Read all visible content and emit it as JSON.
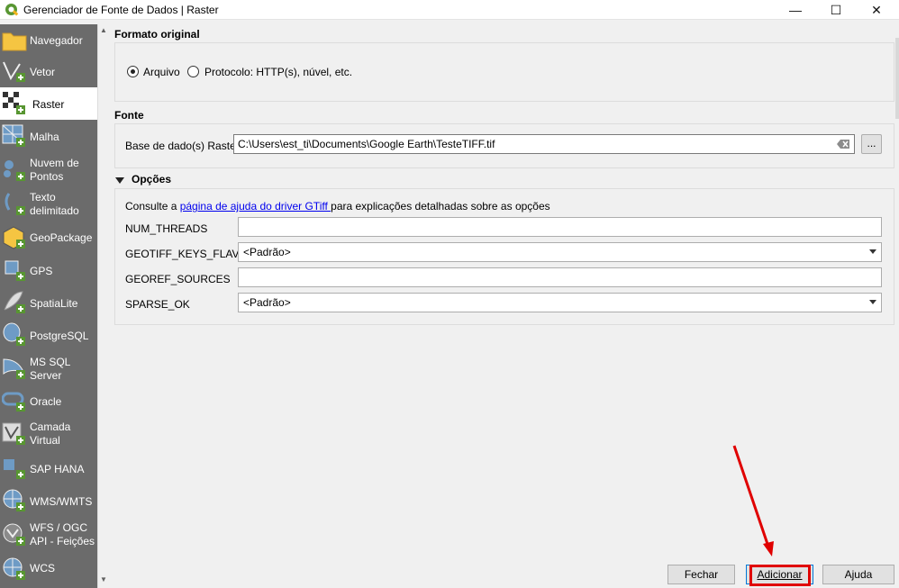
{
  "window": {
    "title": "Gerenciador de Fonte de Dados | Raster",
    "minimize": "—",
    "maximize": "☐",
    "close": "✕"
  },
  "sidebar": {
    "items": [
      {
        "label": "Navegador",
        "icon": "folder-icon"
      },
      {
        "label": "Vetor",
        "icon": "vector-add-icon"
      },
      {
        "label": "Raster",
        "icon": "raster-add-icon",
        "selected": true
      },
      {
        "label": "Malha",
        "icon": "mesh-add-icon"
      },
      {
        "label": "Nuvem de\nPontos",
        "icon": "point-cloud-add-icon"
      },
      {
        "label": "Texto\ndelimitado",
        "icon": "delimited-text-add-icon"
      },
      {
        "label": "GeoPackage",
        "icon": "geopackage-add-icon"
      },
      {
        "label": "GPS",
        "icon": "gps-add-icon"
      },
      {
        "label": "SpatiaLite",
        "icon": "spatialite-add-icon"
      },
      {
        "label": "PostgreSQL",
        "icon": "postgresql-add-icon"
      },
      {
        "label": "MS SQL\nServer",
        "icon": "mssql-add-icon"
      },
      {
        "label": "Oracle",
        "icon": "oracle-add-icon"
      },
      {
        "label": "Camada\nVirtual",
        "icon": "virtual-layer-add-icon"
      },
      {
        "label": "SAP HANA",
        "icon": "sap-hana-add-icon"
      },
      {
        "label": "WMS/WMTS",
        "icon": "wms-add-icon"
      },
      {
        "label": "WFS / OGC\nAPI - Feições",
        "icon": "wfs-add-icon"
      },
      {
        "label": "WCS",
        "icon": "wcs-add-icon"
      }
    ]
  },
  "formato": {
    "title": "Formato original",
    "option_file": "Arquivo",
    "option_protocol": "Protocolo: HTTP(s), núvel, etc.",
    "selected": "Arquivo"
  },
  "fonte": {
    "title": "Fonte",
    "label": "Base de dado(s) Raster",
    "value": "C:\\Users\\est_ti\\Documents\\Google Earth\\TesteTIFF.tif",
    "browse": "..."
  },
  "opcoes": {
    "title": "Opções",
    "help_prefix": "Consulte a ",
    "help_link": "página de ajuda do driver GTiff ",
    "help_suffix": "para explicações detalhadas sobre as opções",
    "fields": [
      {
        "name": "NUM_THREADS",
        "type": "text",
        "value": ""
      },
      {
        "name": "GEOTIFF_KEYS_FLAVOR",
        "type": "combo",
        "value": "<Padrão>"
      },
      {
        "name": "GEOREF_SOURCES",
        "type": "text",
        "value": ""
      },
      {
        "name": "SPARSE_OK",
        "type": "combo",
        "value": "<Padrão>"
      }
    ]
  },
  "buttons": {
    "close": "Fechar",
    "add": "Adicionar",
    "help": "Ajuda"
  },
  "colors": {
    "sidebar_bg": "#6b6b6b",
    "highlight": "#e00000",
    "link": "#0000ee",
    "qgis_green": "#589632"
  }
}
